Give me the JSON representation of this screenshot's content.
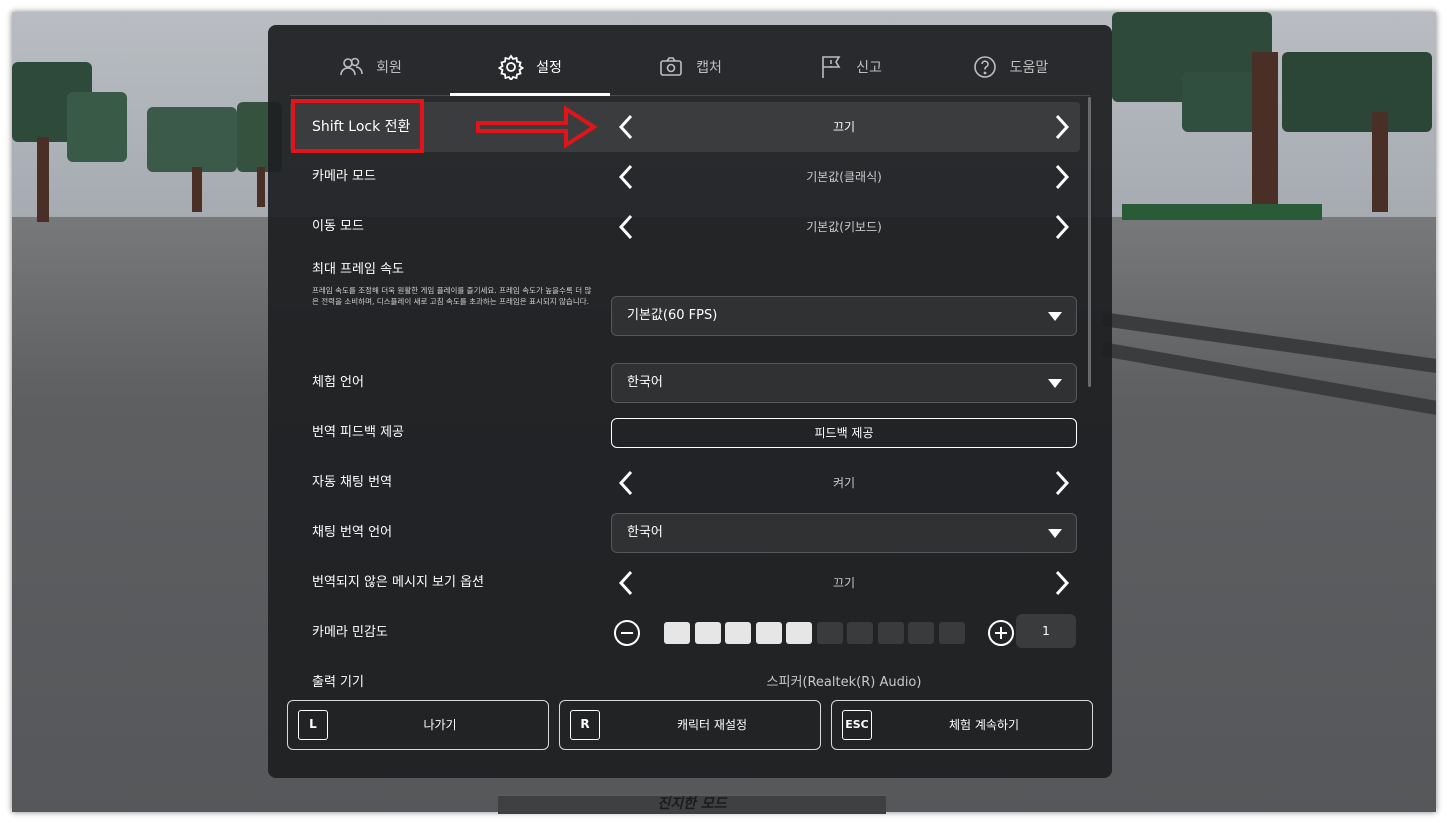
{
  "tabs": [
    {
      "label": "회원",
      "icon": "people-icon"
    },
    {
      "label": "설정",
      "icon": "gear-icon",
      "active": true
    },
    {
      "label": "캡처",
      "icon": "camera-icon"
    },
    {
      "label": "신고",
      "icon": "flag-icon"
    },
    {
      "label": "도움말",
      "icon": "help-icon"
    }
  ],
  "settings": {
    "shift_lock": {
      "label": "Shift Lock 전환",
      "value": "끄기"
    },
    "camera_mode": {
      "label": "카메라 모드",
      "value": "기본값(클래식)"
    },
    "movement_mode": {
      "label": "이동 모드",
      "value": "기본값(키보드)"
    },
    "max_framerate": {
      "label": "최대 프레임 속도",
      "description": "프레임 속도를 조정해 더욱 원활한 게임 플레이를 즐기세요. 프레임 속도가 높을수록 더 많은 전력을 소비하며, 디스플레이 새로 고침 속도를 초과하는 프레임은 표시되지 않습니다.",
      "value": "기본값(60 FPS)"
    },
    "experience_language": {
      "label": "체험 언어",
      "value": "한국어"
    },
    "translation_feedback": {
      "label": "번역 피드백 제공",
      "button": "피드백 제공"
    },
    "auto_chat_translation": {
      "label": "자동 채팅 번역",
      "value": "켜기"
    },
    "chat_translation_language": {
      "label": "채팅 번역 언어",
      "value": "한국어"
    },
    "untranslated_messages": {
      "label": "번역되지 않은 메시지 보기 옵션",
      "value": "끄기"
    },
    "camera_sensitivity": {
      "label": "카메라 민감도",
      "value": "1",
      "level": 5,
      "max": 10
    },
    "output_device": {
      "label": "출력 기기",
      "value": "스피커(Realtek(R) Audio)"
    }
  },
  "bottom_buttons": [
    {
      "key": "L",
      "label": "나가기"
    },
    {
      "key": "R",
      "label": "캐릭터 재설정"
    },
    {
      "key": "ESC",
      "label": "체험 계속하기"
    }
  ],
  "footer_mode": "진지한 모드",
  "colors": {
    "annotation": "#e0141b",
    "panel_bg": "#1e1f21",
    "highlight_row": "#3b3c3e",
    "slider_on": "#e6e6e6",
    "slider_off": "#3a3b3d"
  }
}
